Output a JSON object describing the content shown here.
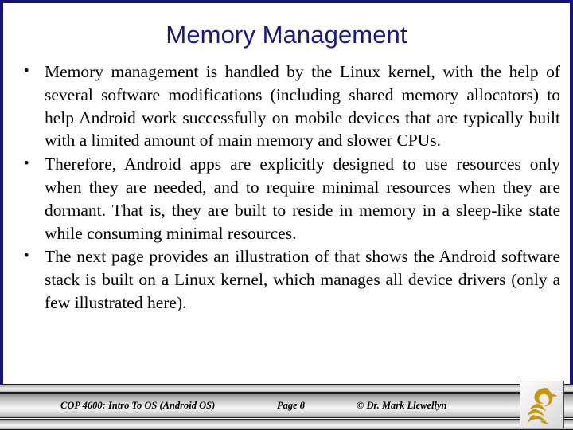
{
  "slide": {
    "title": "Memory Management",
    "accent_color": "#181887",
    "frame_color": "#13137e",
    "background_color": "#ffffff"
  },
  "content": {
    "bullets": [
      "Memory management is handled by the Linux kernel, with the help of several software modifications (including shared memory allocators) to help Android work successfully on mobile devices that are typically built with a limited amount of main memory and slower CPUs.",
      "Therefore, Android apps are explicitly designed to use resources only when they are needed, and to require minimal resources when they are dormant.  That is, they are built to reside in memory in a sleep-like state while consuming minimal resources.",
      "The next page provides an illustration of that shows the Android software stack is built on a Linux kernel, which manages all device drivers (only a few illustrated here)."
    ]
  },
  "footer": {
    "course": "COP 4600: Intro To OS  (Android OS)",
    "page": "Page 8",
    "copyright": "© Dr. Mark Llewellyn",
    "logo_name": "ucf-pegasus-logo",
    "logo_color": "#c8960c"
  }
}
